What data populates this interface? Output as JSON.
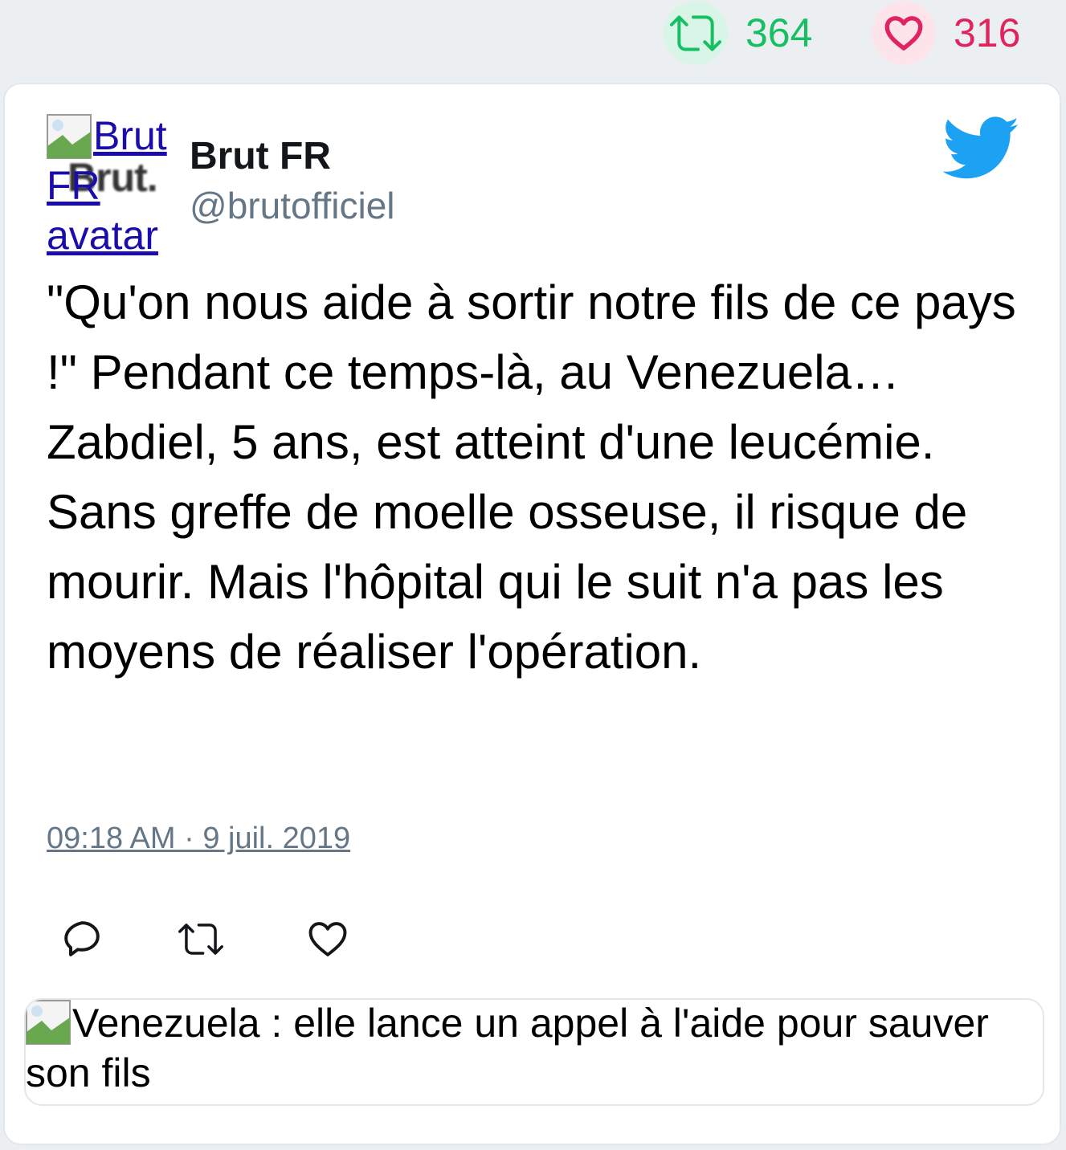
{
  "stats": {
    "retweets": "364",
    "likes": "316",
    "retweet_icon": "retweet-icon",
    "like_icon": "heart-icon"
  },
  "tweet": {
    "avatar_alt": "Brut FR avatar",
    "avatar_logo_text": "Brut.",
    "author_name": "Brut FR",
    "author_handle": "@brutofficiel",
    "text": "\"Qu'on nous aide à sortir notre fils de ce pays !\" Pendant ce temps-là, au Venezuela… Zabdiel, 5 ans, est atteint d'une leucémie. Sans greffe de moelle osseuse, il risque de mourir. Mais l'hôpital qui le suit n'a pas les moyens de réaliser l'opération.",
    "timestamp": "09:18 AM · 9 juil. 2019",
    "brand_icon": "twitter-bird-icon"
  },
  "actions": [
    "reply-icon",
    "retweet-icon",
    "heart-icon"
  ],
  "preview": {
    "alt": "Venezuela : elle lance un appel à l'aide pour sauver son fils"
  },
  "colors": {
    "retweet": "#17bf63",
    "like": "#e0245e",
    "twitter_blue": "#1da1f2",
    "muted": "#657786"
  }
}
